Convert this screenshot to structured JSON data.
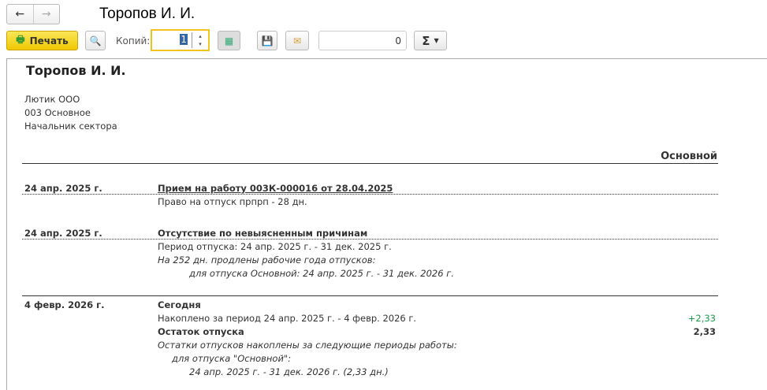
{
  "window": {
    "title": "Торопов И. И.",
    "back": "←",
    "forward": "→"
  },
  "toolbar": {
    "print_label": "Печать",
    "copies_label": "Копий:",
    "copies_value": "1",
    "counter_value": "0",
    "sum_label": "Σ"
  },
  "doc": {
    "name": "Торопов И. И.",
    "org": "Лютик ООО",
    "dept": "003 Основное",
    "position": "Начальник сектора",
    "column": "Основной",
    "entries": [
      {
        "date": "24 апр. 2025 г.",
        "title": "Прием на работу 003К-000016 от 28.04.2025",
        "lines": [
          "Право на отпуск прпрп - 28 дн."
        ]
      },
      {
        "date": "24 апр. 2025 г.",
        "title": "Отсутствие по невыясненным причинам",
        "lines": [
          "Период отпуска: 24 апр. 2025 г. - 31 дек. 2025 г.",
          "На 252 дн. продлены рабочие года отпусков:",
          "для отпуска Основной: 24 апр. 2025 г. - 31 дек. 2026 г."
        ]
      },
      {
        "date": "4 февр. 2026 г.",
        "title": "Сегодня",
        "lines": [
          "Накоплено за период 24 апр. 2025 г. - 4 февр. 2026 г.",
          "Остаток отпуска",
          "Остатки отпусков накоплены за следующие периоды работы:",
          "для отпуска \"Основной\":",
          "24 апр. 2025 г. - 31 дек. 2026 г. (2,33 дн.)"
        ],
        "accrued": "+2,33",
        "balance": "2,33"
      }
    ]
  },
  "colors": {
    "accent": "#f5d21c",
    "positive": "#1a9a4a"
  }
}
